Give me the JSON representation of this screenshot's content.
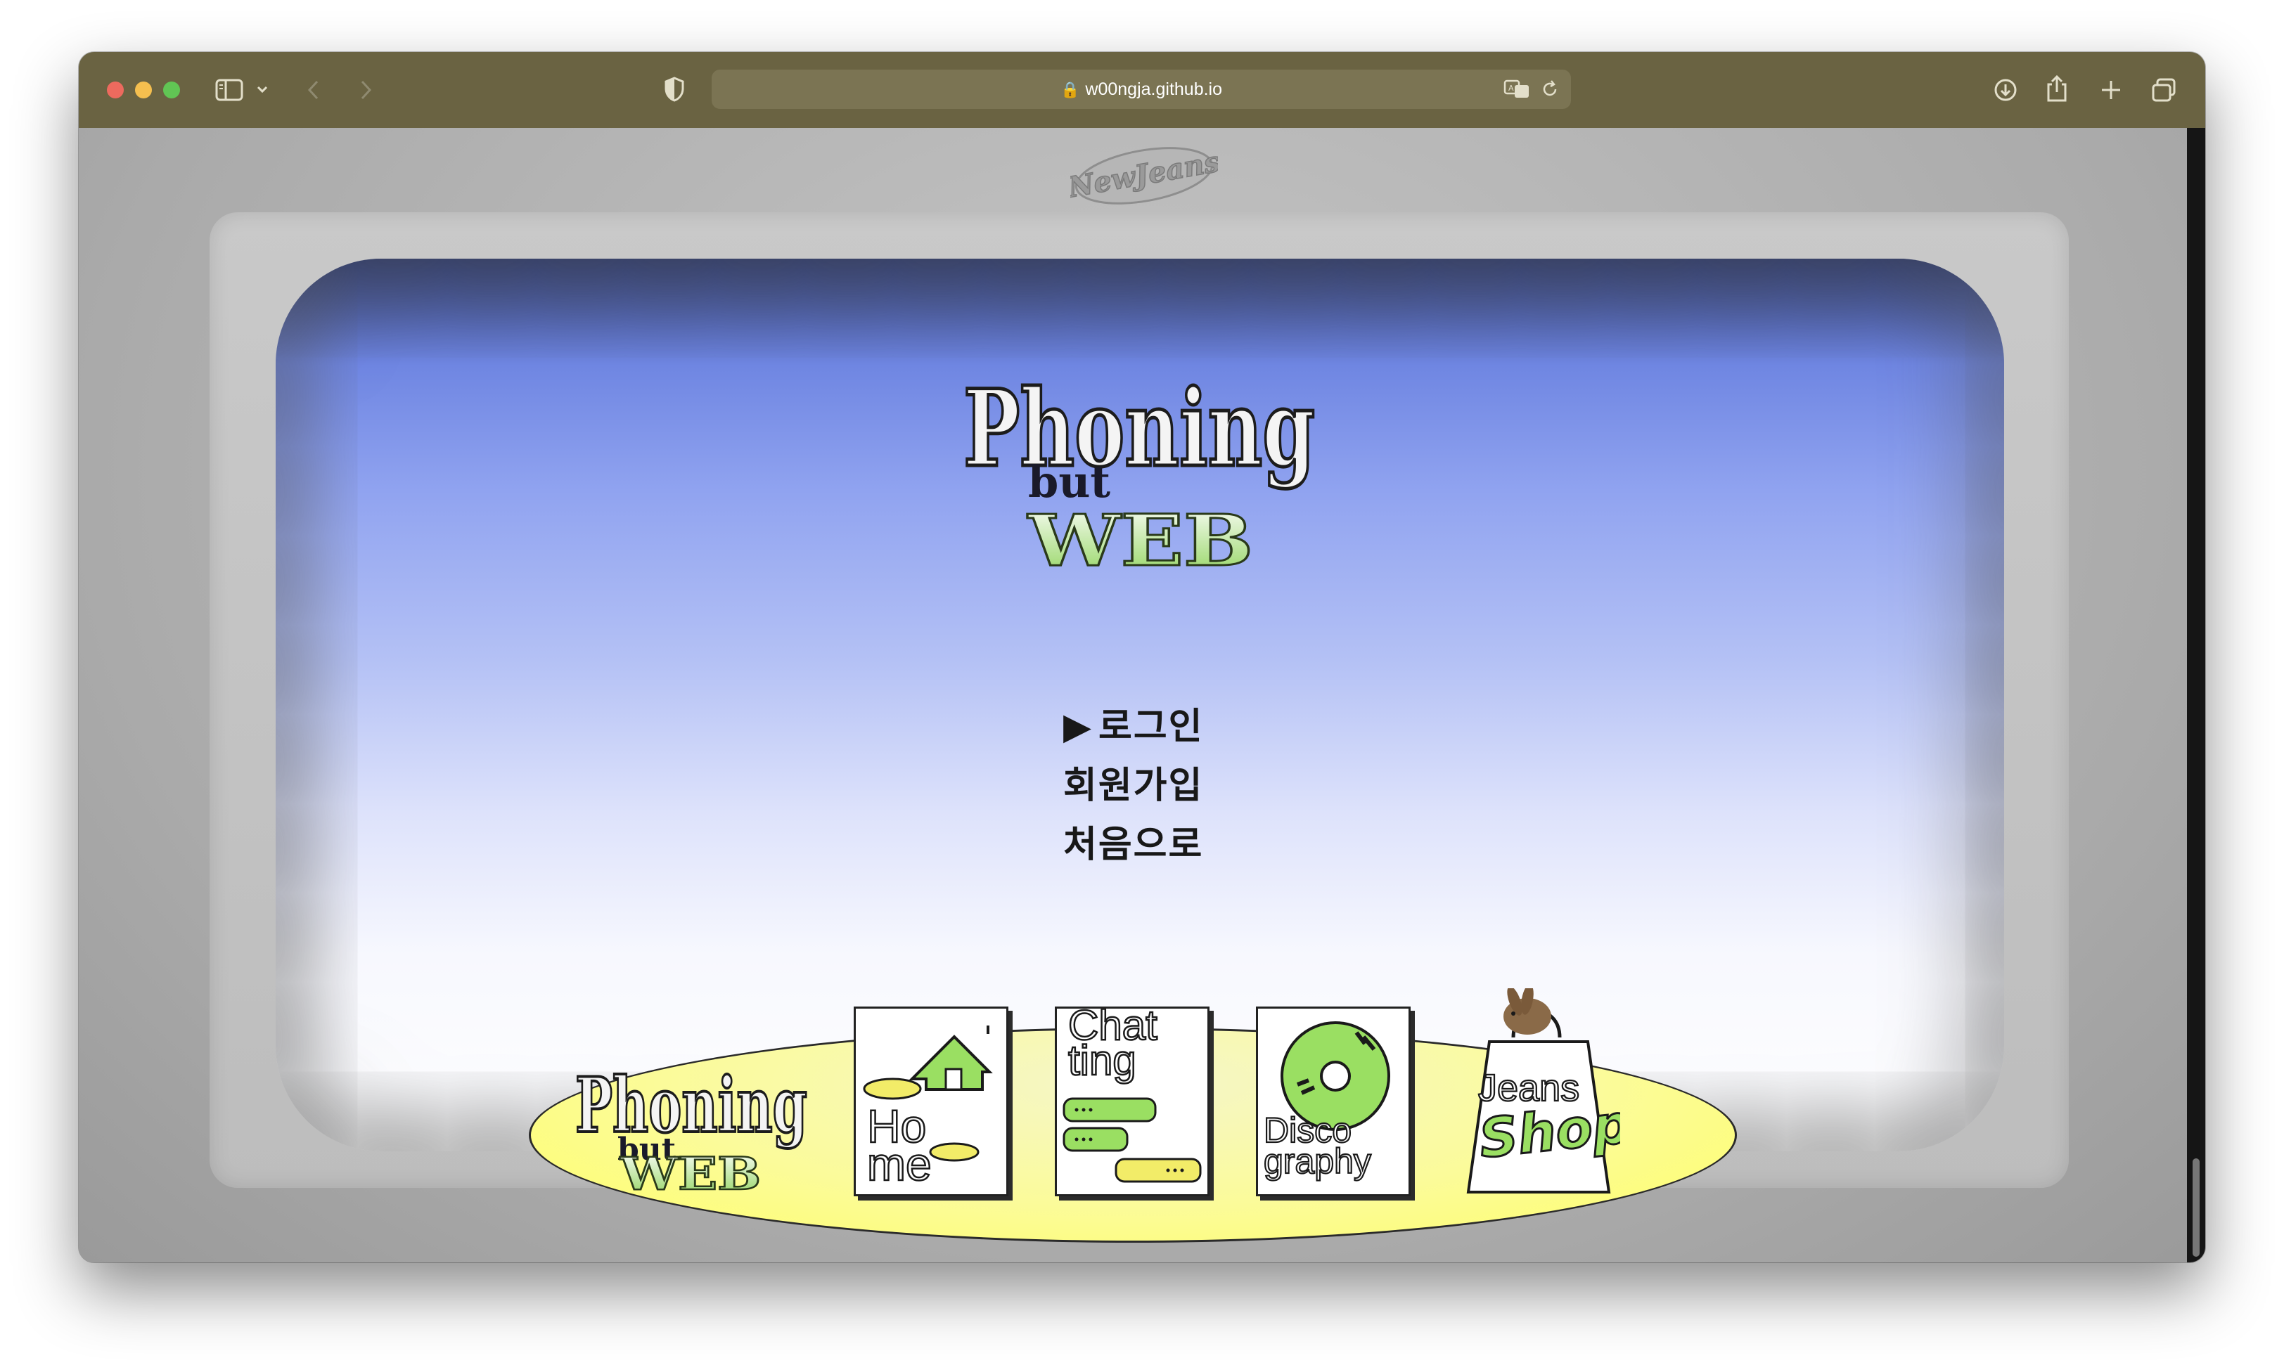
{
  "browser": {
    "url": "w00ngja.github.io"
  },
  "site": {
    "brand_logo": "NewJeans",
    "title": {
      "line1": "Phoning",
      "line2": "but",
      "line3": "WEB"
    },
    "menu": {
      "selected_marker": "▶",
      "items": [
        "로그인",
        "회원가입",
        "처음으로"
      ]
    },
    "dock": {
      "logo": {
        "line1": "Phoning",
        "line2": "but",
        "line3": "WEB"
      },
      "home": {
        "line1": "Ho",
        "line2": "me"
      },
      "chatting": {
        "line1": "Chat",
        "line2": "ting"
      },
      "discography": {
        "line1": "Disco",
        "line2": "graphy"
      },
      "shop": {
        "line1": "Jeans",
        "line2": "Shop"
      }
    }
  },
  "colors": {
    "toolbar": "#6a6342",
    "screen_top": "#2d3c78",
    "screen_mid": "#90a3f0",
    "dock_yellow": "#ffff66",
    "accent_green": "#8fd35a"
  }
}
